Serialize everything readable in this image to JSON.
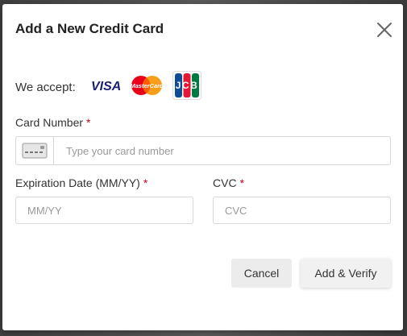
{
  "modal": {
    "title": "Add a New Credit Card",
    "accept_label": "We accept:",
    "logos": [
      {
        "name": "visa-logo",
        "text": "VISA"
      },
      {
        "name": "mastercard-logo",
        "text": "MasterCard"
      },
      {
        "name": "jcb-logo",
        "text": "JCB"
      }
    ]
  },
  "card_number": {
    "label": "Card Number",
    "required_mark": "*",
    "placeholder": "Type your card number",
    "value": ""
  },
  "expiration": {
    "label": "Expiration Date (MM/YY)",
    "required_mark": "*",
    "placeholder": "MM/YY",
    "value": ""
  },
  "cvc": {
    "label": "CVC",
    "required_mark": "*",
    "placeholder": "CVC",
    "value": ""
  },
  "buttons": {
    "cancel": "Cancel",
    "add_verify": "Add & Verify"
  },
  "colors": {
    "required": "#d0021b",
    "visa": "#1a1f71",
    "mastercard_red": "#eb001b",
    "mastercard_orange": "#f79e1b",
    "jcb_blue": "#0e4c96",
    "jcb_red": "#e21836",
    "jcb_green": "#007b40"
  }
}
